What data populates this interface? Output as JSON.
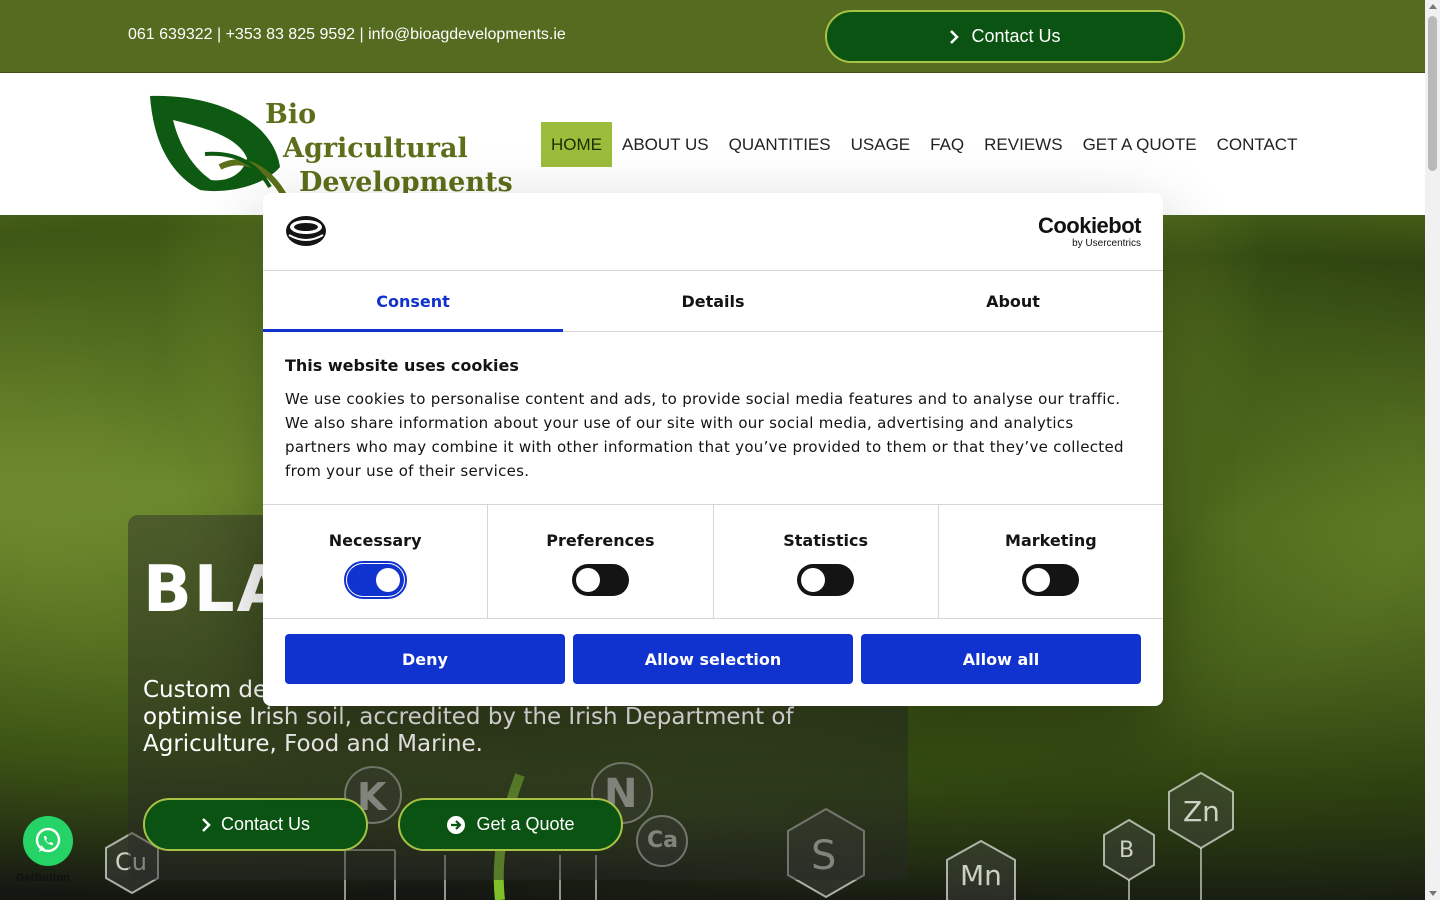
{
  "topbar": {
    "contact_line": "061 639322 | +353 83 825 9592 | info@bioagdevelopments.ie",
    "contact_button": "Contact Us"
  },
  "logo": {
    "line1": "Bio",
    "line2": "Agricultural",
    "line3": "Developments"
  },
  "nav": {
    "items": [
      "HOME",
      "ABOUT US",
      "QUANTITIES",
      "USAGE",
      "FAQ",
      "REVIEWS",
      "GET A QUOTE",
      "CONTACT"
    ],
    "active": "HOME"
  },
  "hero": {
    "headline": "BLA",
    "subtext_line1": "Custom de",
    "subtext_line2": "optimise Irish soil, accredited by the Irish Department of",
    "subtext_line3": "Agriculture, Food and Marine.",
    "contact_button": "Contact Us",
    "quote_button": "Get a Quote",
    "elements": [
      "K",
      "N",
      "Ca",
      "S",
      "Cu",
      "Zn",
      "B",
      "Mn"
    ]
  },
  "cookie": {
    "brand": "Cookiebot",
    "brand_sub": "by Usercentrics",
    "tabs": [
      "Consent",
      "Details",
      "About"
    ],
    "active_tab": "Consent",
    "title": "This website uses cookies",
    "text": "We use cookies to personalise content and ads, to provide social media features and to analyse our traffic. We also share information about your use of our site with our social media, advertising and analytics partners who may combine it with other information that you’ve provided to them or that they’ve collected from your use of their services.",
    "toggles": [
      {
        "label": "Necessary",
        "on": true
      },
      {
        "label": "Preferences",
        "on": false
      },
      {
        "label": "Statistics",
        "on": false
      },
      {
        "label": "Marketing",
        "on": false
      }
    ],
    "buttons": {
      "deny": "Deny",
      "allow_selection": "Allow selection",
      "allow_all": "Allow all"
    },
    "accent_color": "#1032cf"
  },
  "whatsapp": {
    "label": "GetButton"
  },
  "colors": {
    "topbar": "#556b1f",
    "button_green": "#0b5312",
    "nav_active": "#9cbc3c"
  }
}
